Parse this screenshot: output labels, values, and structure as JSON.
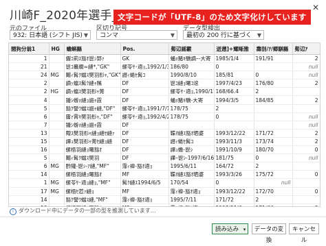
{
  "window": {
    "title": "川崎F_2020年選手_utf8.csv",
    "close_glyph": "✕"
  },
  "banner": "文字コードが「UTF-8」のため文字化けしています",
  "controls": {
    "origin_label": "元のファイル",
    "origin_value": "932: 日本語 (シフト JIS)",
    "delimiter_label": "区切り記号",
    "delimiter_value": "コンマ",
    "detect_label": "データ型検出",
    "detect_value": "最初の 200 行に基づく"
  },
  "table": {
    "headers": [
      "閭狗分翁1",
      "HG",
      "蟾蝌縣",
      "Pos.",
      "髣辺謡霰",
      "迸遡]+耀晰雅",
      "壽剖/ｱ/郷騏縣",
      "髣辺ｱ"
    ],
    "rows": [
      [
        "1",
        "",
        "儼ｺ莉ｽ豁ｵ鬯ｼ郢ｧ",
        "GK",
        "蛹ｫ豬ｷ驕謫ｰ-大寄",
        "1985/1/4",
        "191/91",
        "2"
      ],
      [
        "21",
        "",
        "鬯ｺ蟇繝∞縺*,\"GK\"",
        "縲苓ｻ･遖ｮ,1992/1/31",
        "186/80",
        "0",
        "",
        "null"
      ],
      [
        "24",
        "MG",
        "鬮ｨ髯ｸ蟷ｽ樊羽髟ｬ,\"GK\"",
        "譛ｨ蜷ｾ髯ｺ",
        "1990/8/10",
        "185/81",
        "0",
        "null"
      ],
      [
        "2",
        "",
        "謫ｯ蟷ｽ髯ｸ縺ｬ隲",
        "DF",
        "鬯ｺ縺ｮ曙ｺ逡",
        "1997/4/23",
        "176/80",
        "2"
      ],
      [
        "2",
        "HG",
        "謫ｯ蟷ｽ樊羽髟ｬ莠",
        "DF",
        "縲苓ｻ･遖ｮ,1990/11/13",
        "168/66.4",
        "2"
      ],
      [
        "4",
        "",
        "鍾ｼ蝣ｫ縺ｮ謳ｬ霞",
        "DF",
        "蛹ｫ豬ｷ驕-大寄",
        "1994/3/5",
        "184/85",
        "2"
      ],
      [
        "5",
        "",
        "豁ｸ譬ｳ蟷ｽ謳ｬ縺,\"DF\"",
        "縲苓ｻ･遖ｮ,1991/7/15",
        "178/75",
        "2"
      ],
      [
        "6",
        "",
        "霳ｧ霄ｷ樊羽髟ｬ,\"DF\"",
        "縲苓ｻ･遖ｮ,1992/4/25",
        "178/75",
        "0",
        "",
        "null"
      ],
      [
        "7",
        "",
        "鍾ｼ蝣ｫ縺ｮ謳ｬ霞",
        "DF",
        "",
        "",
        "",
        "null"
      ],
      [
        "13",
        "",
        "陬ｽ樊羽髟ｬ縺ｮ縺ｾ縺ｧ",
        "DF",
        "鞢ｵ縺ｽ豁ｵ晒婆",
        "1993/12/22",
        "171/72",
        "2"
      ],
      [
        "15",
        "",
        "譚ｭ樊羽髟ｬ莠ｾ縺ｮ縺",
        "DF",
        "譛ｨ蜷ｾ髯ｺ",
        "1993/11/3",
        "173/74",
        "2"
      ],
      [
        "16",
        "",
        "縲梧羽縺ｮ曙豁ｵ",
        "DF",
        "譚ｭ蟾-鬯ｼ",
        "1991/10/9",
        "180/70",
        "0"
      ],
      [
        "5",
        "",
        "鬮ｨ髯ｸ蟷ｽ樊羽",
        "DF",
        "譁ｰ鬯ｼ-1997/6/16",
        "181/75",
        "0",
        "null"
      ],
      [
        "6",
        "MG",
        "酢隴-鬯ｼ-ｱ縺,\"MF\"",
        "霪ｨ禕-豁ｵ遖ｮ",
        "1995/6/11",
        "164/72",
        "2"
      ],
      [
        "14",
        "",
        "縲梧羽縺ｮ曙豁ｵ",
        "MF",
        "鞢ｵ縺ｽ豁ｵ晒婆",
        "1993/3/26",
        "175/72",
        "0"
      ],
      [
        "1",
        "MG",
        "縲苓ｻ･遖ｮ縺ｮ,\"MF\"",
        "髯ｸ縺ｽ1994/6/5",
        "170/54",
        "0",
        "null"
      ],
      [
        "17",
        "MG",
        "縲梧ｾ荵ｧ縺ｮ",
        "MF",
        "霪ｨ禕-豁ｵ遖ｮ",
        "1993/12/22",
        "172/70",
        "0"
      ],
      [
        "14",
        "",
        "豁ｸ譬ｳ蟷ｽ縺,\"MF\"",
        "霪ｨ禕-豁ｵ遖ｮ",
        "1995/7/11",
        "171/72",
        "2"
      ],
      [
        "18",
        "",
        "縲梧羽縺ｮ曙豁ｵ",
        "MF",
        "霪ｨ禕-豁ｵ遖ｮ",
        "1993/11/6",
        "171/66",
        "2"
      ],
      [
        "13",
        "",
        "鍾ｼ蝣ｫ縺ｮ謳ｬ霞",
        "MF",
        "霪ｨ禕-豁ｵ遖ｮ",
        "1993/11/18",
        "171/66",
        "2"
      ]
    ]
  },
  "footer": {
    "note": "ダウンロード中にデータの一部の型を推測しています…",
    "load_label": "読み込み",
    "split_glyph": "▾",
    "transform_label": "データの変換",
    "cancel_label": "キャンセル"
  }
}
